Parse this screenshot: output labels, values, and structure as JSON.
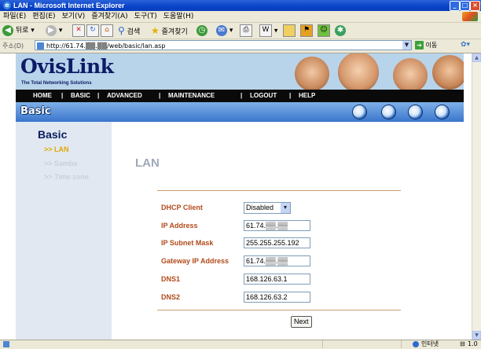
{
  "window": {
    "title": "LAN - Microsoft Internet Explorer",
    "icon": "ie-icon"
  },
  "menu": [
    "파일(E)",
    "편집(E)",
    "보기(V)",
    "즐겨찾기(A)",
    "도구(T)",
    "도움말(H)"
  ],
  "toolbar": {
    "back_label": "뒤로",
    "search_label": "검색",
    "favorites_label": "즐겨찾기"
  },
  "address": {
    "label": "주소(D)",
    "url": "http://61.74.▒▒.▒▒/web/basic/lan.asp",
    "go_label": "이동"
  },
  "statusbar": {
    "zone": "인터넷",
    "zoom": "1.0"
  },
  "page": {
    "logo": "OvisLink",
    "tagline": "The Total Networking Solutions",
    "nav": [
      "HOME",
      "|",
      "BASIC",
      "|",
      "ADVANCED",
      "|",
      "MAINTENANCE",
      "|",
      "LOGOUT",
      "|",
      "HELP"
    ],
    "section_banner": "Basic",
    "sidebar": {
      "heading": "Basic",
      "items": [
        ">> LAN",
        ">> Samba",
        ">> Time zone"
      ],
      "active_color": "#e0a800",
      "inactive_color": "#c8d0dc"
    },
    "main_title": "LAN",
    "form": {
      "dhcp_label": "DHCP Client",
      "dhcp_value": "Disabled",
      "ip_label": "IP Address",
      "ip_value": "61.74.▒▒.▒▒",
      "mask_label": "IP Subnet Mask",
      "mask_value": "255.255.255.192",
      "gateway_label": "Gateway IP Address",
      "gateway_value": "61.74.▒▒.▒▒",
      "dns1_label": "DNS1",
      "dns1_value": "168.126.63.1",
      "dns2_label": "DNS2",
      "dns2_value": "168.126.63.2",
      "next_label": "Next"
    }
  }
}
